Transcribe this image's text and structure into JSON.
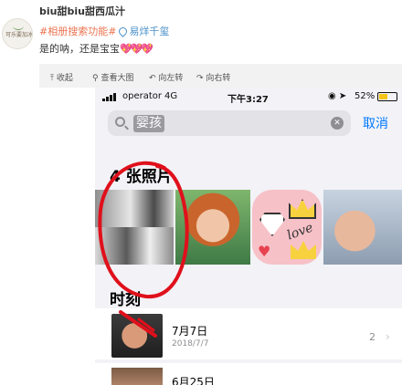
{
  "post": {
    "username": "biu甜biu甜西瓜汁",
    "avatar_text": "可乐要加冰",
    "tag": "#相册搜索功能#",
    "location": "易烊千玺",
    "text": "是的呐，还是宝宝",
    "hearts": "💖💖💖"
  },
  "toolbar": {
    "items": [
      {
        "icon": "collapse-icon",
        "label": "收起"
      },
      {
        "icon": "search-icon",
        "label": "查看大图"
      },
      {
        "icon": "rotate-left-icon",
        "label": "向左转"
      },
      {
        "icon": "rotate-right-icon",
        "label": "向右转"
      }
    ]
  },
  "phone": {
    "status": {
      "carrier": "operator",
      "network": "4G",
      "time": "下午3:27",
      "battery": "52%",
      "battery_level": 0.52
    },
    "search": {
      "query": "婴孩",
      "cancel": "取消"
    },
    "photos_header": "4 张照片",
    "moments_header": "时刻",
    "moments": [
      {
        "title": "7月7日",
        "date": "2018/7/7",
        "count": "2"
      },
      {
        "title": "6月25日"
      }
    ],
    "thumb_texts": {
      "love": "love"
    }
  },
  "colors": {
    "accent": "#007aff",
    "tag": "#eb7350",
    "location": "#4a90c8",
    "scribble": "#e0101b"
  }
}
